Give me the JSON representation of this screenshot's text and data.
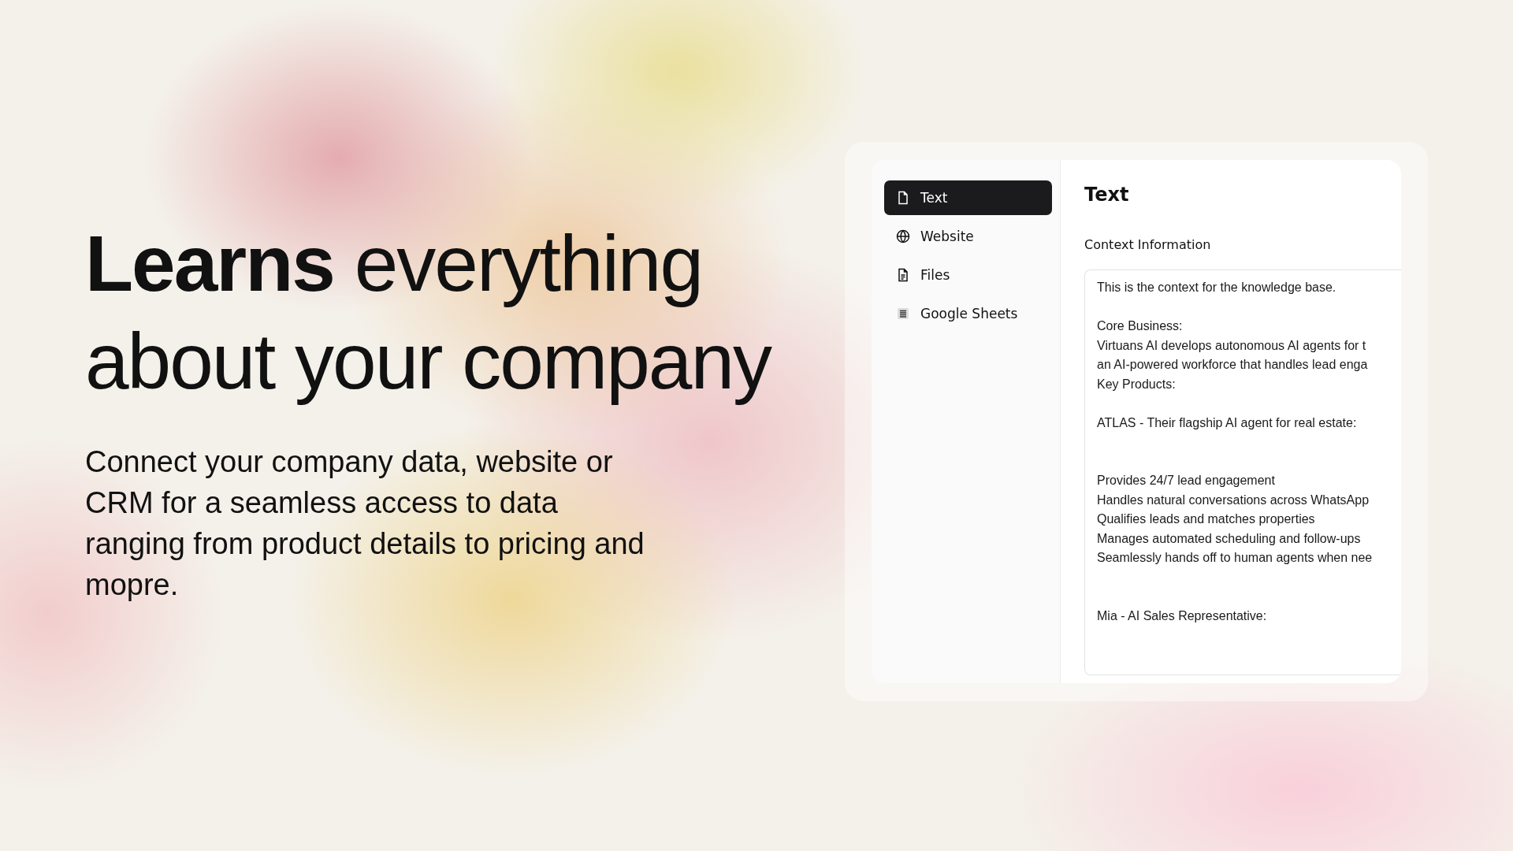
{
  "hero": {
    "headline_lines": [
      "**Learns** everything",
      "about your company"
    ],
    "description": "Connect your company data, website or CRM for a seamless access to data ranging from product details to pricing and mopre."
  },
  "panel": {
    "sources": [
      {
        "label": "Text",
        "kind": "text",
        "selected": true
      },
      {
        "label": "Website",
        "kind": "website",
        "selected": false
      },
      {
        "label": "Files",
        "kind": "files",
        "selected": false
      },
      {
        "label": "Google Sheets",
        "kind": "sheets",
        "selected": false
      }
    ],
    "title": "Text",
    "field_label": "Context Information",
    "context_blocks": [
      {
        "kind": "paragraph",
        "lines": [
          "This is the context for the knowledge base."
        ]
      },
      {
        "kind": "paragraph",
        "lines": [
          "Core Business:",
          "Virtuans AI develops autonomous AI agents for t",
          "an AI-powered workforce that handles lead enga",
          "Key Products:"
        ]
      },
      {
        "kind": "paragraph",
        "lines": [
          "ATLAS - Their flagship AI agent for real estate:"
        ]
      },
      {
        "kind": "section",
        "lines": [
          "Provides 24/7 lead engagement",
          "Handles natural conversations across WhatsApp",
          "Qualifies leads and matches properties",
          "Manages automated scheduling and follow-ups",
          "Seamlessly hands off to human agents when nee"
        ]
      },
      {
        "kind": "section",
        "lines": [
          "Mia - AI Sales Representative:"
        ]
      }
    ]
  }
}
